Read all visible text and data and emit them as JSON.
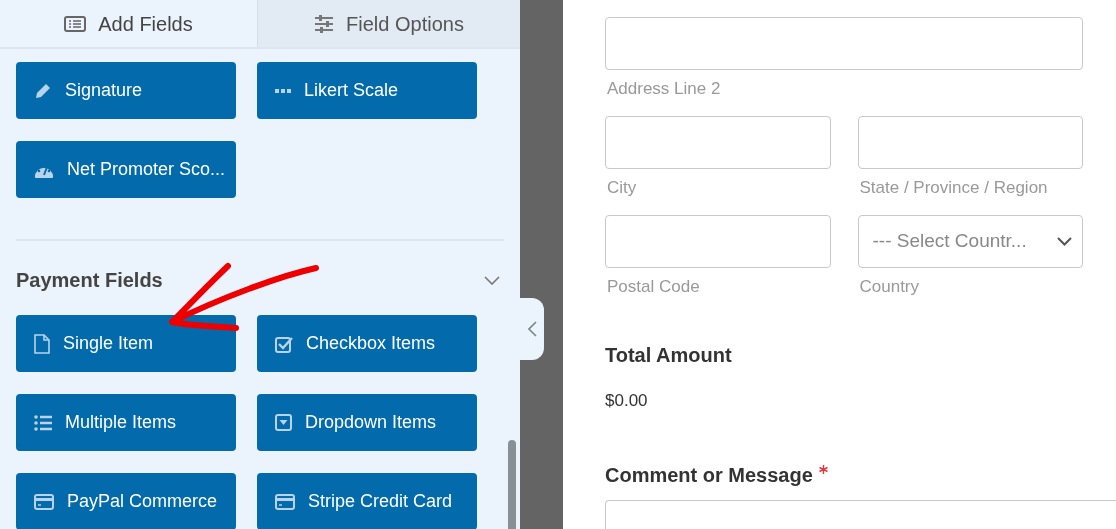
{
  "tabs": [
    {
      "label": "Add Fields",
      "selected": true
    },
    {
      "label": "Field Options",
      "selected": false
    }
  ],
  "field_groups": [
    {
      "buttons": [
        "Signature",
        "Likert Scale",
        "Net Promoter Sco..."
      ]
    },
    {
      "title": "Payment Fields",
      "expanded": true,
      "buttons": [
        "Single Item",
        "Checkbox Items",
        "Multiple Items",
        "Dropdown Items",
        "PayPal Commerce",
        "Stripe Credit Card"
      ]
    }
  ],
  "form": {
    "rows": [
      [
        {
          "kind": "text",
          "sublabel": "Address Line 2"
        }
      ],
      [
        {
          "kind": "text",
          "sublabel": "City"
        },
        {
          "kind": "text",
          "sublabel": "State / Province / Region"
        }
      ],
      [
        {
          "kind": "text",
          "sublabel": "Postal Code"
        },
        {
          "kind": "select",
          "placeholder": "--- Select Countr...",
          "sublabel": "Country"
        }
      ]
    ],
    "total": {
      "label": "Total Amount",
      "value": "$0.00"
    },
    "comment": {
      "label": "Comment or Message",
      "required": true
    }
  }
}
